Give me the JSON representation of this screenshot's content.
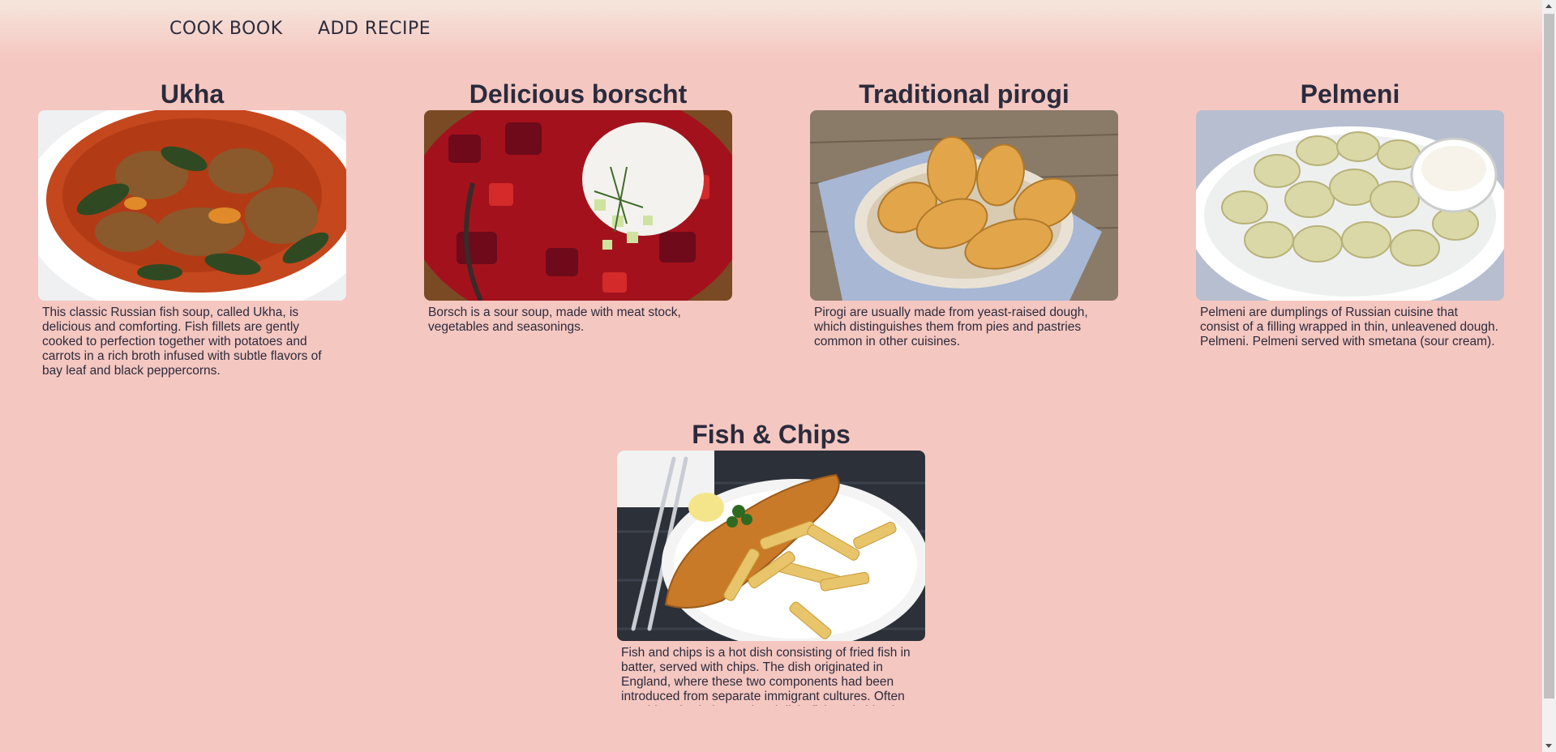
{
  "nav": {
    "cook_book": "COOK BOOK",
    "add_recipe": "ADD RECIPE"
  },
  "recipes": [
    {
      "title": "Ukha",
      "image": "ukha-fish-soup-photo",
      "description": "This classic Russian fish soup, called Ukha, is delicious and comforting. Fish fillets are gently cooked to perfection together with potatoes and carrots in a rich broth infused with subtle flavors of bay leaf and black peppercorns."
    },
    {
      "title": "Delicious borscht",
      "image": "borscht-photo",
      "description": "Borsch is a sour soup, made with meat stock, vegetables and seasonings."
    },
    {
      "title": "Traditional pirogi",
      "image": "pirogi-photo",
      "description": "Pirogi are usually made from yeast-raised dough, which distinguishes them from pies and pastries common in other cuisines."
    },
    {
      "title": "Pelmeni",
      "image": "pelmeni-photo",
      "description": "Pelmeni are dumplings of Russian cuisine that consist of a filling wrapped in thin, unleavened dough. Pelmeni. Pelmeni served with smetana (sour cream)."
    },
    {
      "title": "Fish & Chips",
      "image": "fish-and-chips-photo",
      "description": "Fish and chips is a hot dish consisting of fried fish in batter, served with chips. The dish originated in England, where these two components had been introduced from separate immigrant cultures. Often considered Britain's national dish, fish and chips is a"
    }
  ],
  "colors": {
    "background": "#f5c7c1",
    "text": "#2b2b3c"
  }
}
